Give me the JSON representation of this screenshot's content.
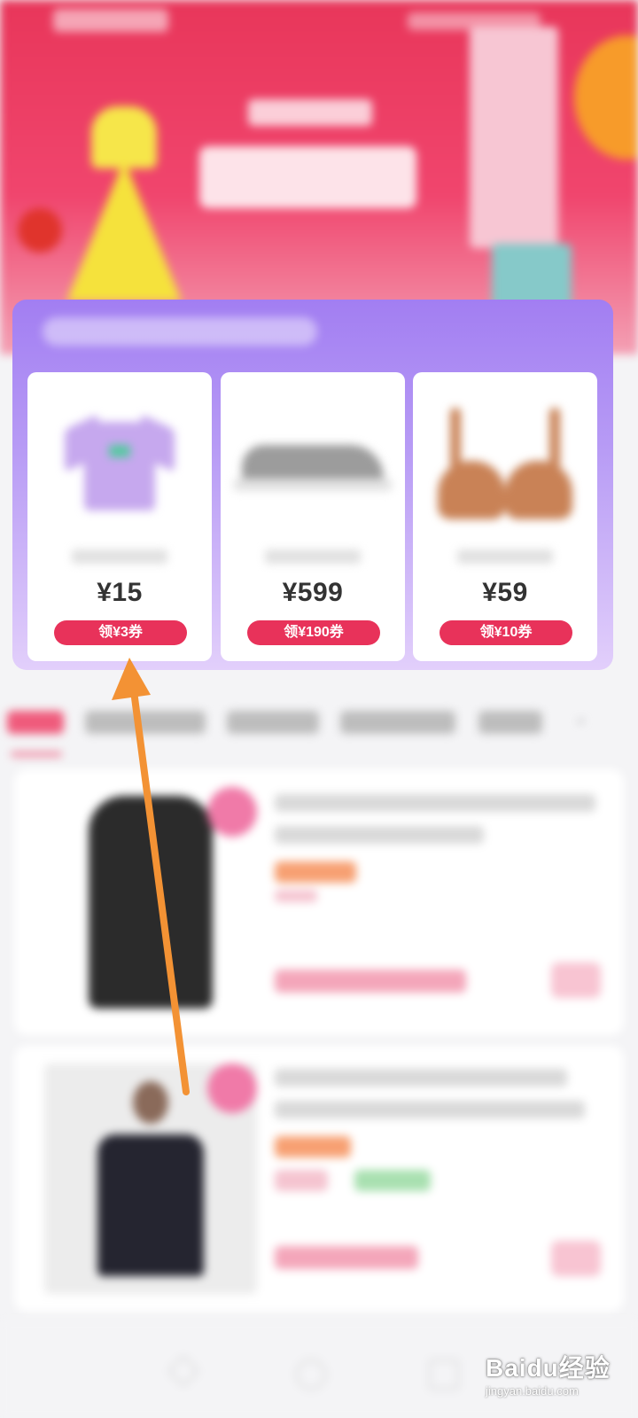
{
  "deals": [
    {
      "name": "",
      "price": "¥15",
      "coupon": "领¥3券"
    },
    {
      "name": "",
      "price": "¥599",
      "coupon": "领¥190券"
    },
    {
      "name": "",
      "price": "¥59",
      "coupon": "领¥10券"
    }
  ],
  "watermark": {
    "main": "Baidu经验",
    "sub": "jingyan.baidu.com"
  },
  "colors": {
    "accent": "#e8325a",
    "panel": "#a27ef2",
    "arrow": "#f39234"
  }
}
